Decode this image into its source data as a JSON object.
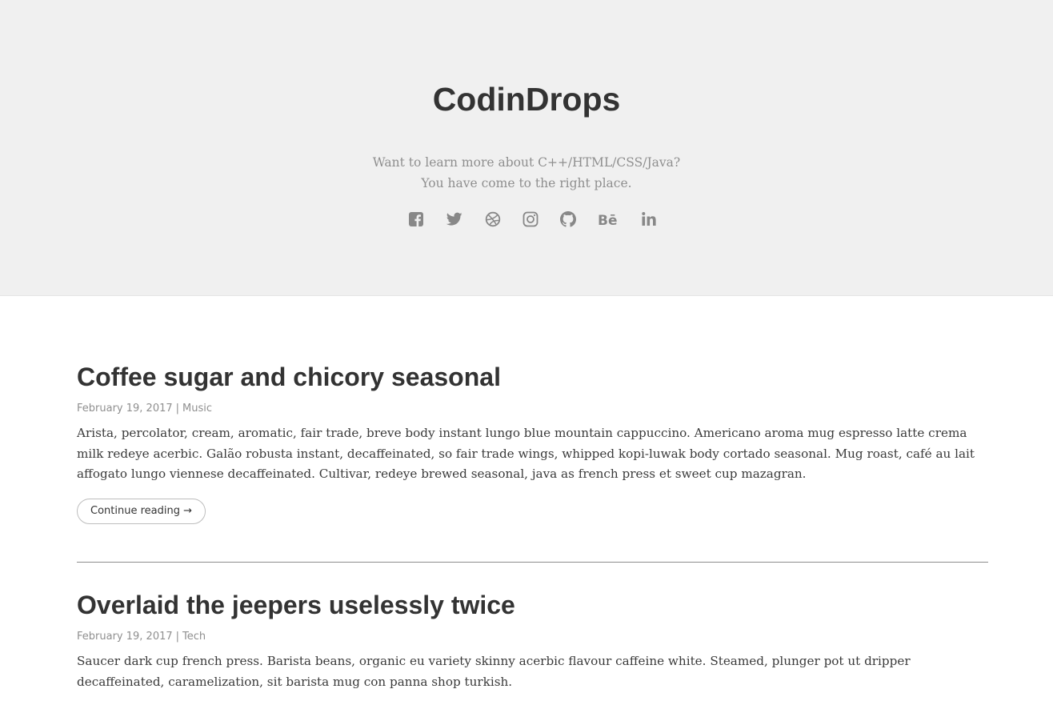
{
  "header": {
    "title": "CodinDrops",
    "description_line1": "Want to learn more about C++/HTML/CSS/Java?",
    "description_line2": "You have come to the right place.",
    "social": [
      {
        "icon": "facebook-icon"
      },
      {
        "icon": "twitter-icon"
      },
      {
        "icon": "dribbble-icon"
      },
      {
        "icon": "instagram-icon"
      },
      {
        "icon": "github-icon"
      },
      {
        "icon": "behance-icon"
      },
      {
        "icon": "linkedin-icon"
      }
    ]
  },
  "posts": [
    {
      "title": "Coffee sugar and chicory seasonal",
      "date": "February 19, 2017",
      "separator": "|",
      "category": "Music",
      "excerpt": "Arista, percolator, cream, aromatic, fair trade, breve body instant lungo blue mountain cappuccino. Americano aroma mug espresso latte crema milk redeye acerbic. Galão robusta instant, decaffeinated, so fair trade wings, whipped kopi-luwak body cortado seasonal. Mug roast, café au lait affogato lungo viennese decaffeinated. Cultivar, redeye brewed seasonal, java as french press et sweet cup mazagran.",
      "continue_label": "Continue reading →"
    },
    {
      "title": "Overlaid the jeepers uselessly twice",
      "date": "February 19, 2017",
      "separator": "|",
      "category": "Tech",
      "excerpt": "Saucer dark cup french press. Barista beans, organic eu variety skinny acerbic flavour caffeine white. Steamed, plunger pot ut dripper decaffeinated, caramelization, sit barista mug con panna shop turkish."
    }
  ],
  "colors": {
    "hero_background": "#f0f0f0",
    "title": "#333333",
    "muted": "#8f8f8f",
    "icon": "#888888",
    "divider": "#8c8c8c"
  }
}
